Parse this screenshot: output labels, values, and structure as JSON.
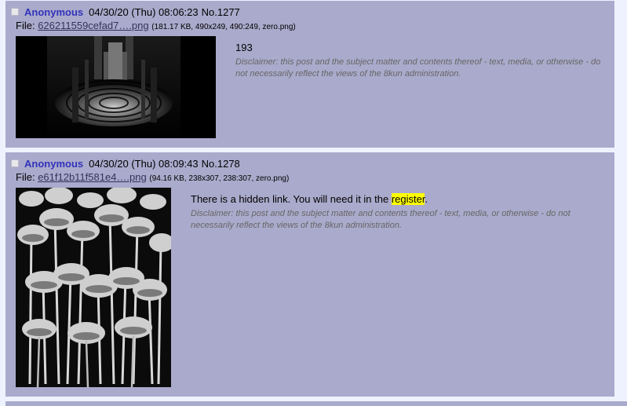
{
  "posts": [
    {
      "name": "Anonymous",
      "date": "04/30/20 (Thu) 08:06:23",
      "number": "No.1277",
      "file_label": "File:",
      "file_name": "626211559cefad7….png",
      "file_meta": "(181.17 KB, 490x249, 490:249, zero.png)",
      "body": "193",
      "disclaimer": "Disclaimer: this post and the subject matter and contents thereof - text, media, or otherwise - do not necessarily reflect the views of the 8kun administration."
    },
    {
      "name": "Anonymous",
      "date": "04/30/20 (Thu) 08:09:43",
      "number": "No.1278",
      "file_label": "File:",
      "file_name": "e61f12b11f581e4….png",
      "file_meta": "(94.16 KB, 238x307, 238:307, zero.png)",
      "body_prefix": "There is a hidden link. You will need it in the ",
      "body_link": "register",
      "body_suffix": ".",
      "disclaimer": "Disclaimer: this post and the subject matter and contents thereof - text, media, or otherwise - do not necessarily reflect the views of the 8kun administration."
    }
  ],
  "colors": {
    "page_bg": "#eef2ff",
    "post_bg": "#aaaacc",
    "name": "#3333bb",
    "highlight": "#ffff00"
  }
}
